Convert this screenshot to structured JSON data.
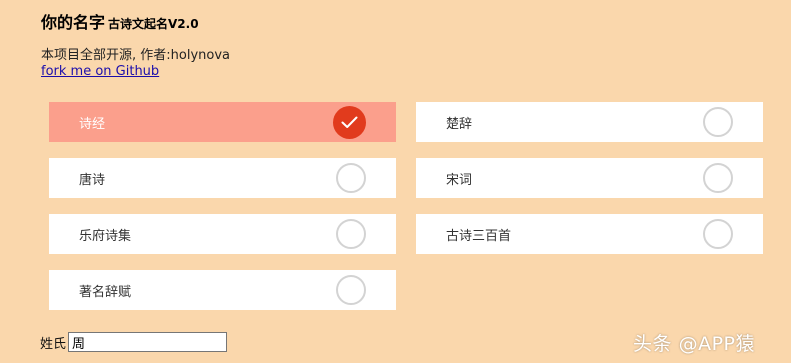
{
  "header": {
    "title": "你的名字",
    "subtitle": "古诗文起名V2.0"
  },
  "credits": {
    "text": "本项目全部开源, 作者:holynova",
    "link": "fork me on Github"
  },
  "options": [
    {
      "label": "诗经",
      "selected": true
    },
    {
      "label": "楚辞",
      "selected": false
    },
    {
      "label": "唐诗",
      "selected": false
    },
    {
      "label": "宋词",
      "selected": false
    },
    {
      "label": "乐府诗集",
      "selected": false
    },
    {
      "label": "古诗三百首",
      "selected": false
    },
    {
      "label": "著名辞赋",
      "selected": false
    }
  ],
  "surname": {
    "label": "姓氏",
    "value": "周"
  },
  "watermark": "头条 @APP猿",
  "colors": {
    "background": "#fad7ac",
    "selected_row": "#fb9f8c",
    "check_active": "#e13b1d",
    "check_inactive_border": "#d3d3d3"
  },
  "icons": {
    "selected": "checkmark-circle-icon",
    "unselected": "empty-circle-icon"
  }
}
